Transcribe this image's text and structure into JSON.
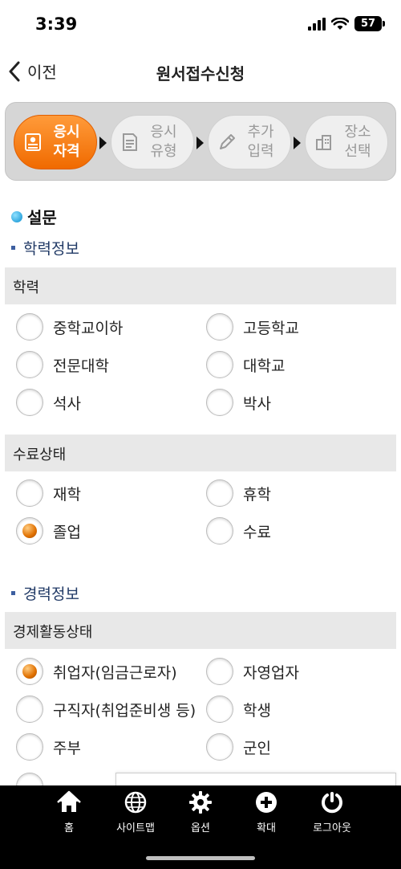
{
  "status": {
    "time": "3:39",
    "battery": "57"
  },
  "nav": {
    "back_label": "이전",
    "title": "원서접수신청"
  },
  "steps": [
    {
      "label": "응시\n자격",
      "icon": "id-card-icon",
      "active": true
    },
    {
      "label": "응시\n유형",
      "icon": "document-icon",
      "active": false
    },
    {
      "label": "추가\n입력",
      "icon": "pencil-icon",
      "active": false
    },
    {
      "label": "장소\n선택",
      "icon": "building-icon",
      "active": false
    }
  ],
  "survey_title": "설문",
  "sections": {
    "education_info": "학력정보",
    "career_info": "경력정보"
  },
  "groups": {
    "education": {
      "label": "학력",
      "options": [
        "중학교이하",
        "고등학교",
        "전문대학",
        "대학교",
        "석사",
        "박사"
      ],
      "selected": null
    },
    "completion": {
      "label": "수료상태",
      "options": [
        "재학",
        "휴학",
        "졸업",
        "수료"
      ],
      "selected": "졸업"
    },
    "employment": {
      "label": "경제활동상태",
      "options": [
        "취업자(임금근로자)",
        "자영업자",
        "구직자(취업준비생 등)",
        "학생",
        "주부",
        "군인"
      ],
      "selected": "취업자(임금근로자)"
    }
  },
  "tabbar": [
    {
      "label": "홈",
      "icon": "home-icon"
    },
    {
      "label": "사이트맵",
      "icon": "globe-icon"
    },
    {
      "label": "옵션",
      "icon": "gear-icon"
    },
    {
      "label": "확대",
      "icon": "zoom-plus-icon"
    },
    {
      "label": "로그아웃",
      "icon": "logout-icon"
    }
  ],
  "colors": {
    "accent": "#f27a0c",
    "heading_blue": "#213a66",
    "bar_bg": "#e8e8e8"
  }
}
